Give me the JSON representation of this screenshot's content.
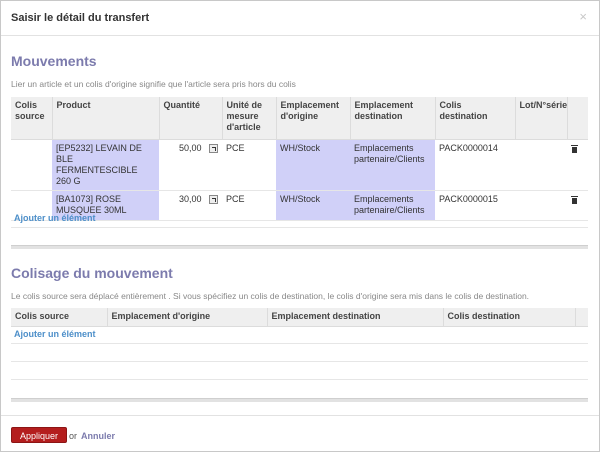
{
  "dialog": {
    "title": "Saisir le détail du transfert",
    "close_symbol": "×"
  },
  "movements": {
    "title": "Mouvements",
    "help": "Lier un article et un colis d'origine signifie que l'article sera pris hors du colis",
    "columns": {
      "colis_source": "Colis source",
      "product": "Product",
      "quantite": "Quantité",
      "unite": "Unité de mesure d'article",
      "emplacement_origine": "Emplacement d'origine",
      "emplacement_destination": "Emplacement destination",
      "colis_destination": "Colis destination",
      "lot": "Lot/N°série"
    },
    "rows": [
      {
        "colis_source": "",
        "product": "[EP5232] LEVAIN DE BLE FERMENTESCIBLE 260 G",
        "quantite": "50,00",
        "unite": "PCE",
        "emplacement_origine": "WH/Stock",
        "emplacement_destination": "Emplacements partenaire/Clients",
        "colis_destination": "PACK0000014",
        "lot": ""
      },
      {
        "colis_source": "",
        "product": "[BA1073] ROSE MUSQUEE 30ML",
        "quantite": "30,00",
        "unite": "PCE",
        "emplacement_origine": "WH/Stock",
        "emplacement_destination": "Emplacements partenaire/Clients",
        "colis_destination": "PACK0000015",
        "lot": ""
      }
    ],
    "add_label": "Ajouter un élément"
  },
  "packaging": {
    "title": "Colisage du mouvement",
    "help": "Le colis source sera déplacé entièrement . Si vous spécifiez un colis de destination, le colis d'origine sera mis dans le colis de destination.",
    "columns": {
      "colis_source": "Colis source",
      "emplacement_origine": "Emplacement d'origine",
      "emplacement_destination": "Emplacement destination",
      "colis_destination": "Colis destination"
    },
    "add_label": "Ajouter un élément"
  },
  "footer": {
    "apply_label": "Appliquer",
    "or_label": "or",
    "cancel_label": "Annuler"
  },
  "colors": {
    "accent": "#7c7bad",
    "highlight": "#d0d0f8",
    "apply_button": "#b41e1e",
    "link": "#4d8fc9"
  },
  "icons": {
    "external_link": "external-link-icon",
    "delete": "trash-icon",
    "close": "close-icon"
  }
}
